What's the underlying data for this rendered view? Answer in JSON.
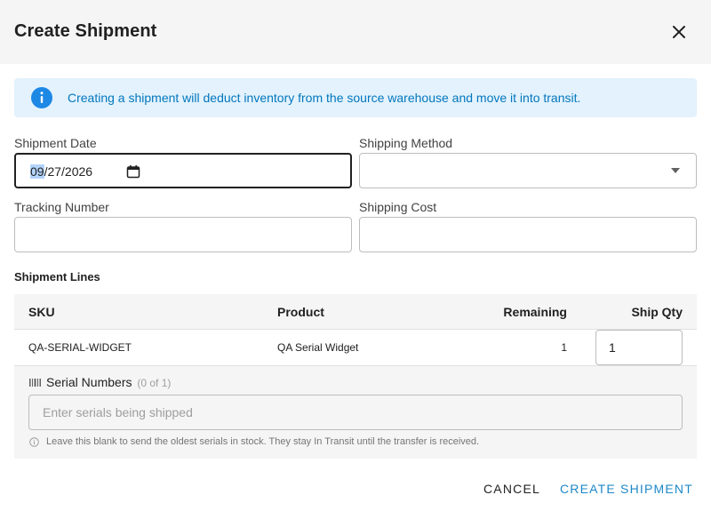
{
  "dialog": {
    "title": "Create Shipment",
    "close_icon": "close-icon"
  },
  "alert": {
    "icon": "info-icon",
    "text": "Creating a shipment will deduct inventory from the source warehouse and move it into transit.",
    "color": "#0277bd",
    "background": "#e3f2fd"
  },
  "form": {
    "shipment_date_label": "Shipment Date",
    "shipment_date_month": "09",
    "shipment_date_rest": "/27/2026",
    "shipping_method_label": "Shipping Method",
    "shipping_method_value": "",
    "tracking_number_label": "Tracking Number",
    "tracking_number_value": "",
    "shipping_cost_label": "Shipping Cost",
    "shipping_cost_value": ""
  },
  "lines": {
    "section_title": "Shipment Lines",
    "columns": [
      "SKU",
      "Product",
      "Remaining",
      "Ship Qty"
    ],
    "rows": [
      {
        "sku": "QA-SERIAL-WIDGET",
        "product": "QA Serial Widget",
        "remaining": "1",
        "ship_qty": "1"
      }
    ]
  },
  "serials": {
    "icon": "barcode-icon",
    "label": "Serial Numbers",
    "count": "(0 of 1)",
    "placeholder": "Enter serials being shipped",
    "hint": "Leave this blank to send the oldest serials in stock. They stay In Transit until the transfer is received."
  },
  "actions": {
    "cancel_label": "Cancel",
    "create_label": "Create Shipment",
    "primary_color": "#1e88c9"
  }
}
